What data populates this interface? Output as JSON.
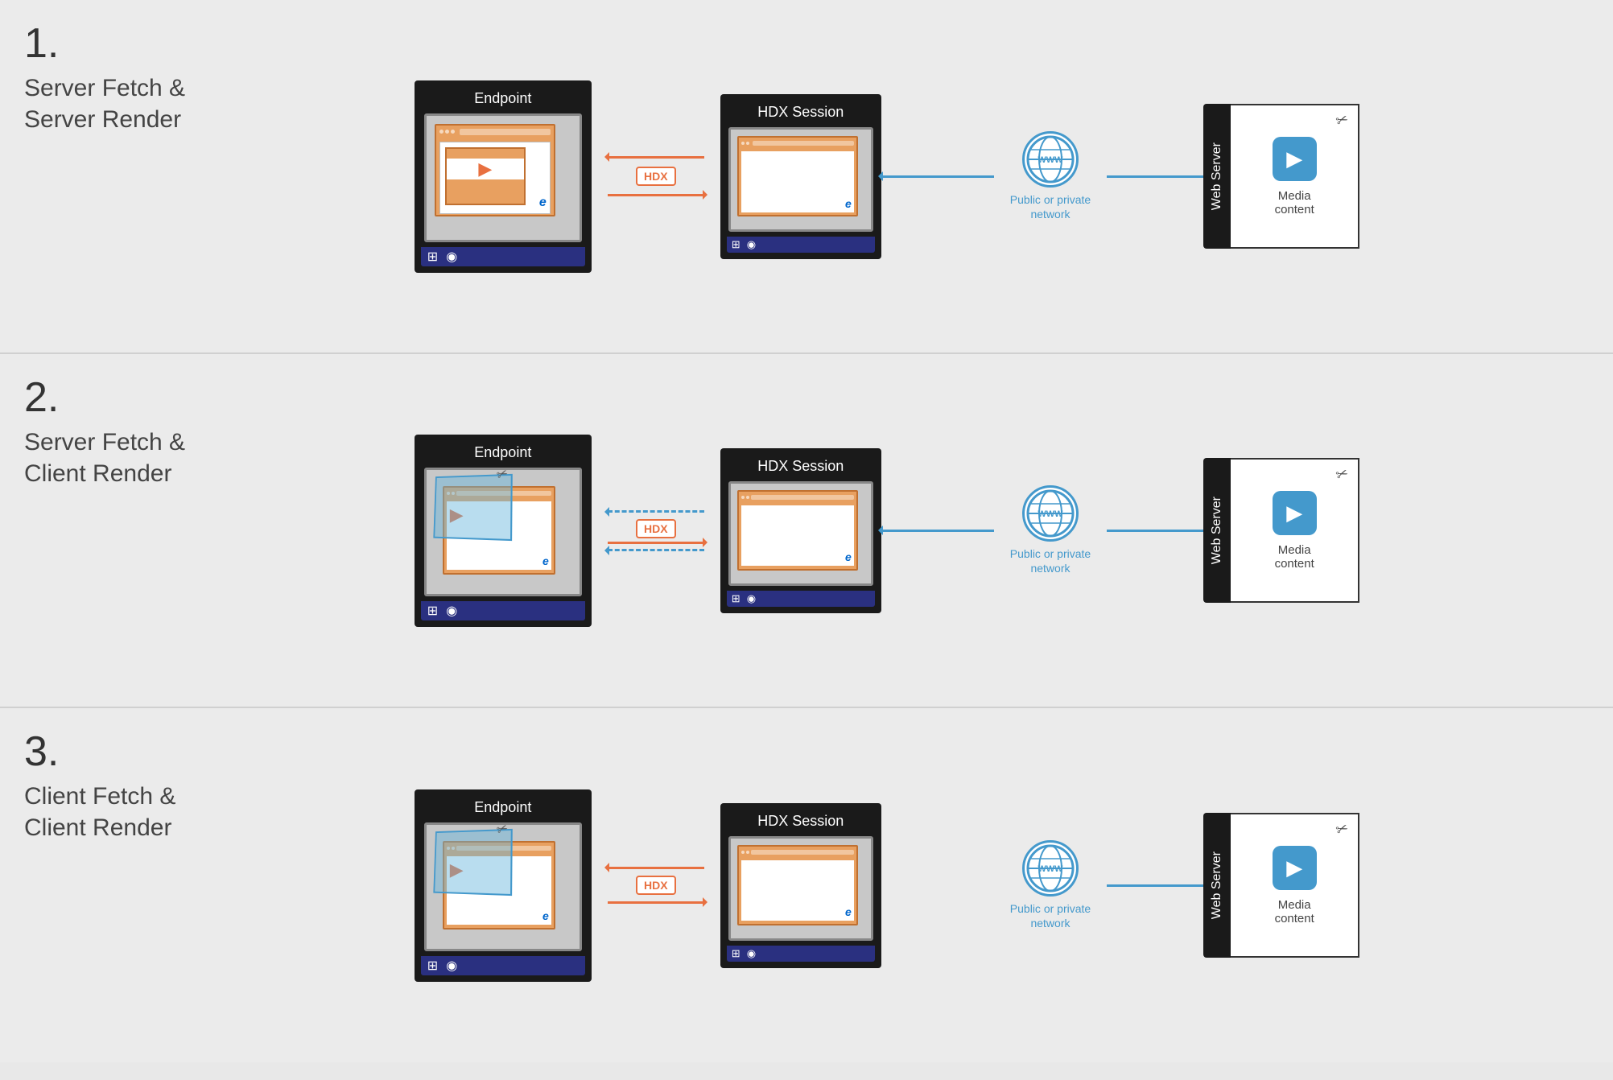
{
  "sections": [
    {
      "number": "1.",
      "title_line1": "Server Fetch &",
      "title_line2": "Server Render",
      "endpoint_label": "Endpoint",
      "hdx_session_label": "HDX Session",
      "web_server_label": "Web Server",
      "media_label": "Media\ncontent",
      "network_label": "Public or private\nnetwork",
      "hdx_badge": "HDX",
      "has_client_render": false,
      "scenario": "server-fetch-server-render"
    },
    {
      "number": "2.",
      "title_line1": "Server Fetch &",
      "title_line2": "Client Render",
      "endpoint_label": "Endpoint",
      "hdx_session_label": "HDX Session",
      "web_server_label": "Web Server",
      "media_label": "Media\ncontent",
      "network_label": "Public or private\nnetwork",
      "hdx_badge": "HDX",
      "has_client_render": true,
      "scenario": "server-fetch-client-render"
    },
    {
      "number": "3.",
      "title_line1": "Client Fetch &",
      "title_line2": "Client Render",
      "endpoint_label": "Endpoint",
      "hdx_session_label": "HDX Session",
      "web_server_label": "Web Server",
      "media_label": "Media\ncontent",
      "network_label": "Public or private\nnetwork",
      "hdx_badge": "HDX",
      "has_client_render": true,
      "scenario": "client-fetch-client-render"
    }
  ],
  "colors": {
    "orange": "#e87040",
    "blue": "#4499cc",
    "dark": "#1a1a1a",
    "white": "#ffffff"
  }
}
